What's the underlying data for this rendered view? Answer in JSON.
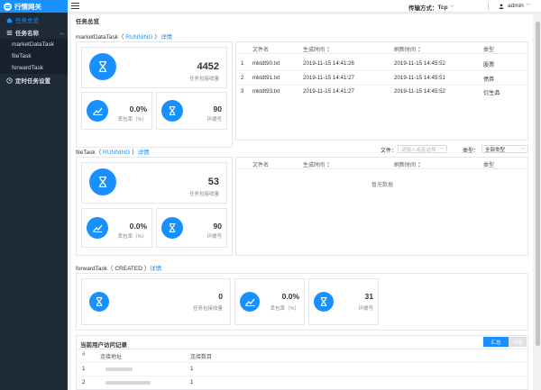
{
  "app": {
    "name": "行情网关"
  },
  "sidebar": {
    "items": [
      {
        "label": "任务总览",
        "active": true
      },
      {
        "label": "任务名称",
        "parent": true
      },
      {
        "label": "marketDataTask"
      },
      {
        "label": "fileTask"
      },
      {
        "label": "forwardTask"
      },
      {
        "label": "定时任务设置"
      }
    ]
  },
  "topbar": {
    "transport_label": "传输方式：",
    "transport_value": "Tcp",
    "user": "admin"
  },
  "page": {
    "title": "任务总览"
  },
  "tasks": [
    {
      "name": "marketDataTask",
      "status": "RUNNING",
      "detail_link": "详情",
      "received": "4452",
      "received_label": "任务包接收量",
      "loss_rate": "0.0%",
      "loss_label": "丢包率（%）",
      "ring": "90",
      "ring_label": "环缓号",
      "table": {
        "headers": [
          "文件名",
          "生成时间",
          "刷新时间",
          "类型"
        ],
        "rows": [
          {
            "no": "1",
            "file": "mktdt90.txt",
            "gen": "2019-11-15 14:41:26",
            "refresh": "2019-11-15 14:45:52",
            "type": "股票"
          },
          {
            "no": "2",
            "file": "mktdt91.txt",
            "gen": "2019-11-15 14:41:27",
            "refresh": "2019-11-15 14:45:51",
            "type": "债券"
          },
          {
            "no": "3",
            "file": "mktdt93.txt",
            "gen": "2019-11-15 14:41:27",
            "refresh": "2019-11-15 14:45:52",
            "type": "衍生品"
          }
        ]
      }
    },
    {
      "name": "fileTask",
      "status": "RUNNING",
      "detail_link": "详情",
      "received": "53",
      "received_label": "任务包接收量",
      "loss_rate": "0.0%",
      "loss_label": "丢包率（%）",
      "ring": "90",
      "ring_label": "环缓号",
      "filter_file_label": "文件：",
      "filter_file_placeholder": "请输入或者选择",
      "filter_type_label": "类型：",
      "filter_type_value": "全部类型",
      "table": {
        "headers": [
          "文件名",
          "生成时间",
          "刷新时间",
          "类型"
        ],
        "empty": "暂无数据"
      }
    },
    {
      "name": "forwardTask",
      "status": "CREATED",
      "detail_link": "详情",
      "received": "0",
      "received_label": "任务包接收量",
      "loss_rate": "0.0%",
      "loss_label": "丢包率（%）",
      "ring": "31",
      "ring_label": "环缓号"
    }
  ],
  "visits": {
    "title": "当前用户访问记录",
    "btn_summary": "汇总",
    "btn_detail": "详情",
    "headers": [
      "#",
      "连接地址",
      "连接数目"
    ],
    "rows": [
      {
        "no": "1",
        "count": "1"
      },
      {
        "no": "2",
        "count": "1"
      }
    ]
  },
  "colors": {
    "accent": "#1890ff",
    "sidebar": "#1f2a37"
  }
}
